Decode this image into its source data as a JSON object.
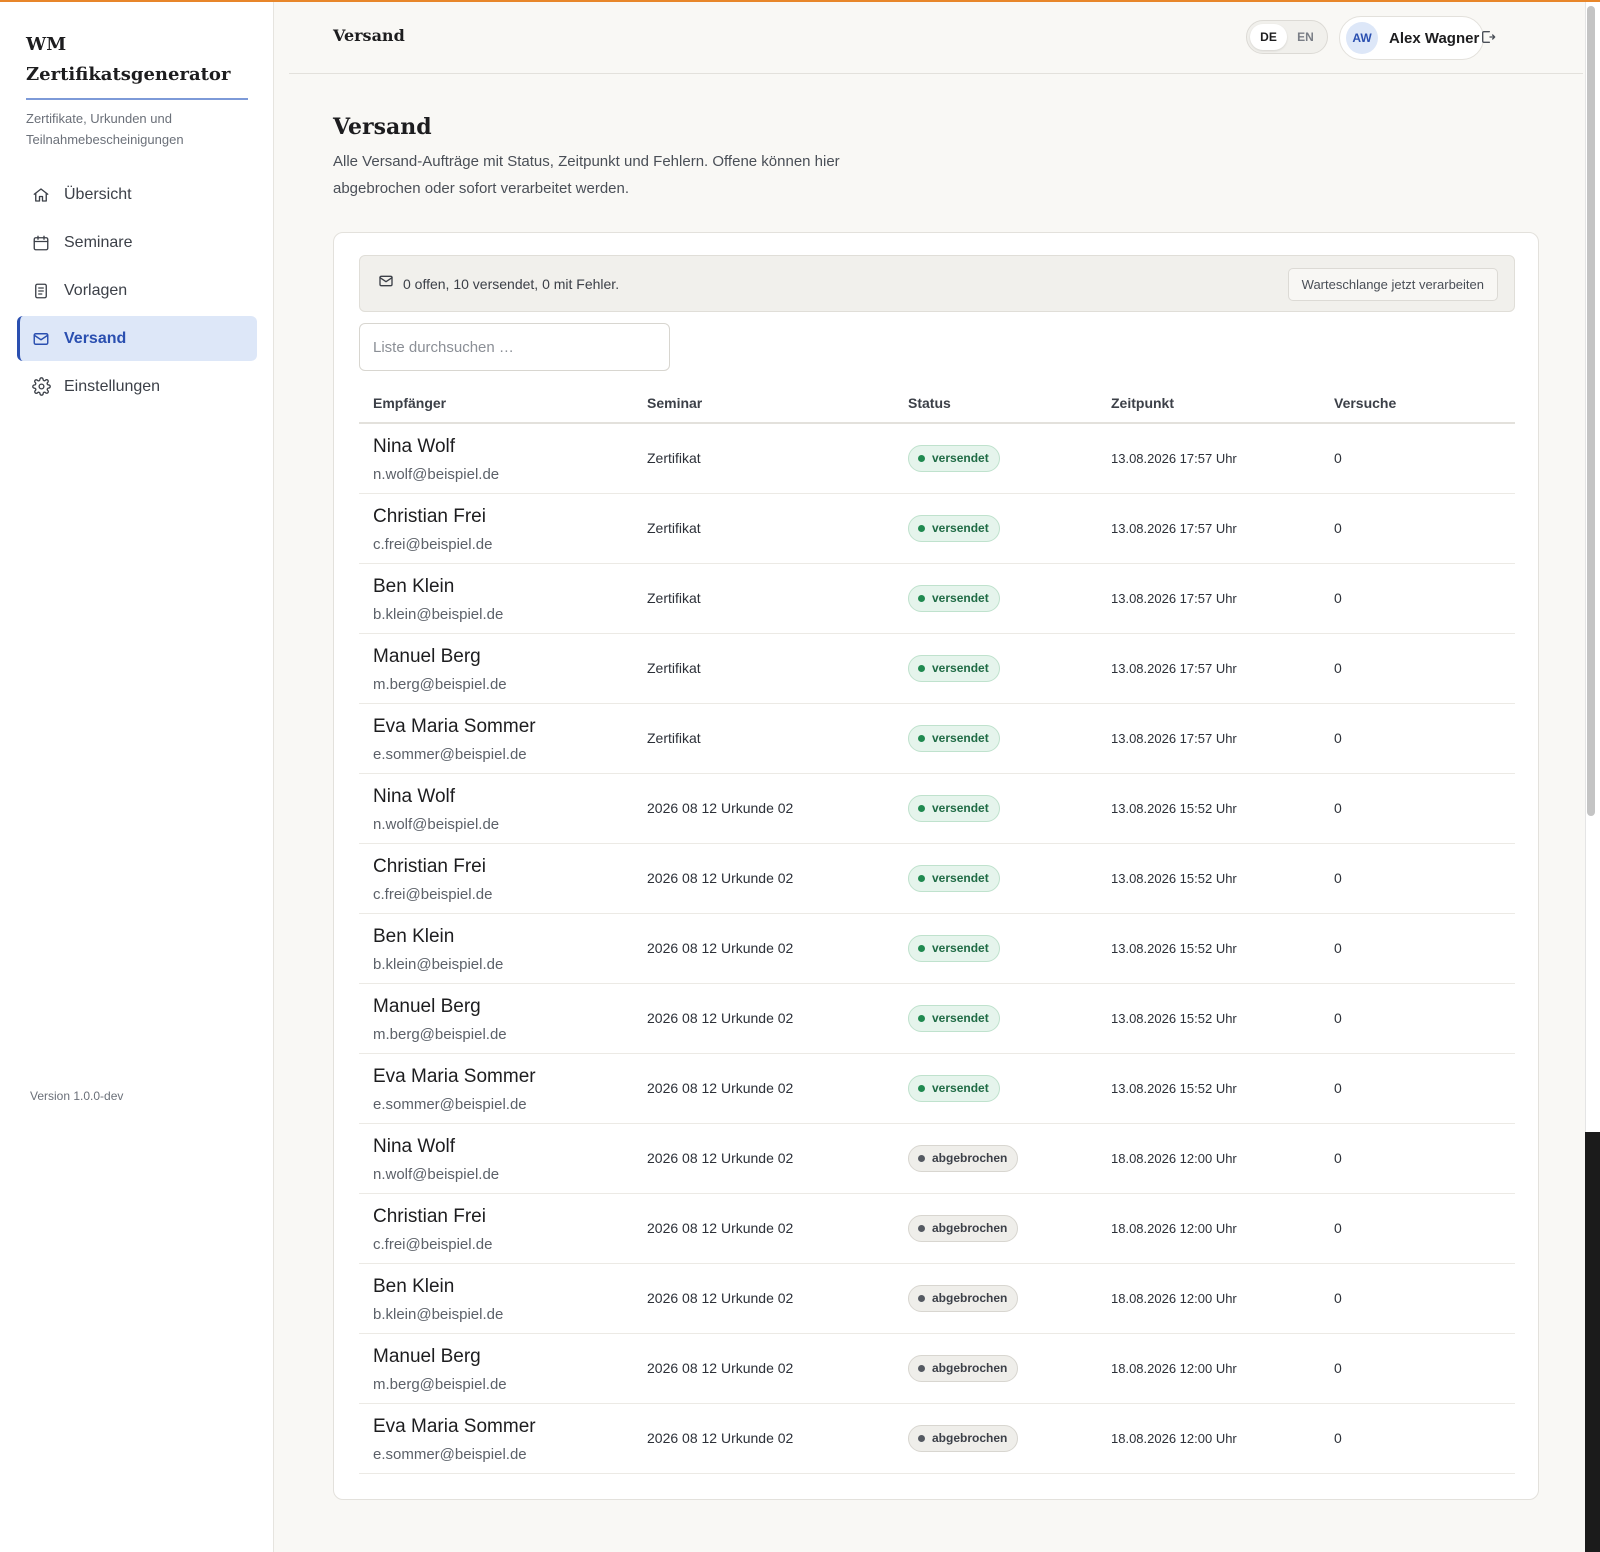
{
  "brand": {
    "title": "WM Zertifikatsgenerator",
    "subtitle": "Zertifikate, Urkunden und Teilnahmebescheinigungen"
  },
  "nav": [
    {
      "label": "Übersicht",
      "icon": "home-icon",
      "active": false
    },
    {
      "label": "Seminare",
      "icon": "calendar-icon",
      "active": false
    },
    {
      "label": "Vorlagen",
      "icon": "document-icon",
      "active": false
    },
    {
      "label": "Versand",
      "icon": "mail-icon",
      "active": true
    },
    {
      "label": "Einstellungen",
      "icon": "gear-icon",
      "active": false
    }
  ],
  "version": "Version 1.0.0-dev",
  "topbar": {
    "title": "Versand",
    "lang_de": "DE",
    "lang_en": "EN",
    "active_lang": "DE",
    "user_initials": "AW",
    "user_name": "Alex Wagner",
    "logout_icon": "logout-icon"
  },
  "page": {
    "title": "Versand",
    "description": "Alle Versand-Aufträge mit Status, Zeitpunkt und Fehlern. Offene können hier abgebrochen oder sofort verarbeitet werden."
  },
  "summary": {
    "text": "0 offen, 10 versendet, 0 mit Fehler.",
    "process_button": "Warteschlange jetzt verarbeiten"
  },
  "search": {
    "placeholder": "Liste durchsuchen …",
    "value": ""
  },
  "table": {
    "headers": [
      "Empfänger",
      "Seminar",
      "Status",
      "Zeitpunkt",
      "Versuche"
    ],
    "rows": [
      {
        "name": "Nina Wolf",
        "email": "n.wolf@beispiel.de",
        "seminar": "Zertifikat",
        "status": "versendet",
        "time": "13.08.2026 17:57 Uhr",
        "attempts": "0"
      },
      {
        "name": "Christian Frei",
        "email": "c.frei@beispiel.de",
        "seminar": "Zertifikat",
        "status": "versendet",
        "time": "13.08.2026 17:57 Uhr",
        "attempts": "0"
      },
      {
        "name": "Ben Klein",
        "email": "b.klein@beispiel.de",
        "seminar": "Zertifikat",
        "status": "versendet",
        "time": "13.08.2026 17:57 Uhr",
        "attempts": "0"
      },
      {
        "name": "Manuel Berg",
        "email": "m.berg@beispiel.de",
        "seminar": "Zertifikat",
        "status": "versendet",
        "time": "13.08.2026 17:57 Uhr",
        "attempts": "0"
      },
      {
        "name": "Eva Maria Sommer",
        "email": "e.sommer@beispiel.de",
        "seminar": "Zertifikat",
        "status": "versendet",
        "time": "13.08.2026 17:57 Uhr",
        "attempts": "0"
      },
      {
        "name": "Nina Wolf",
        "email": "n.wolf@beispiel.de",
        "seminar": "2026 08 12 Urkunde 02",
        "status": "versendet",
        "time": "13.08.2026 15:52 Uhr",
        "attempts": "0"
      },
      {
        "name": "Christian Frei",
        "email": "c.frei@beispiel.de",
        "seminar": "2026 08 12 Urkunde 02",
        "status": "versendet",
        "time": "13.08.2026 15:52 Uhr",
        "attempts": "0"
      },
      {
        "name": "Ben Klein",
        "email": "b.klein@beispiel.de",
        "seminar": "2026 08 12 Urkunde 02",
        "status": "versendet",
        "time": "13.08.2026 15:52 Uhr",
        "attempts": "0"
      },
      {
        "name": "Manuel Berg",
        "email": "m.berg@beispiel.de",
        "seminar": "2026 08 12 Urkunde 02",
        "status": "versendet",
        "time": "13.08.2026 15:52 Uhr",
        "attempts": "0"
      },
      {
        "name": "Eva Maria Sommer",
        "email": "e.sommer@beispiel.de",
        "seminar": "2026 08 12 Urkunde 02",
        "status": "versendet",
        "time": "13.08.2026 15:52 Uhr",
        "attempts": "0"
      },
      {
        "name": "Nina Wolf",
        "email": "n.wolf@beispiel.de",
        "seminar": "2026 08 12 Urkunde 02",
        "status": "abgebrochen",
        "time": "18.08.2026 12:00 Uhr",
        "attempts": "0"
      },
      {
        "name": "Christian Frei",
        "email": "c.frei@beispiel.de",
        "seminar": "2026 08 12 Urkunde 02",
        "status": "abgebrochen",
        "time": "18.08.2026 12:00 Uhr",
        "attempts": "0"
      },
      {
        "name": "Ben Klein",
        "email": "b.klein@beispiel.de",
        "seminar": "2026 08 12 Urkunde 02",
        "status": "abgebrochen",
        "time": "18.08.2026 12:00 Uhr",
        "attempts": "0"
      },
      {
        "name": "Manuel Berg",
        "email": "m.berg@beispiel.de",
        "seminar": "2026 08 12 Urkunde 02",
        "status": "abgebrochen",
        "time": "18.08.2026 12:00 Uhr",
        "attempts": "0"
      },
      {
        "name": "Eva Maria Sommer",
        "email": "e.sommer@beispiel.de",
        "seminar": "2026 08 12 Urkunde 02",
        "status": "abgebrochen",
        "time": "18.08.2026 12:00 Uhr",
        "attempts": "0"
      }
    ]
  },
  "colors": {
    "accent": "#2a4fb0",
    "nav_active_bg": "#dde7f8",
    "top_line": "#e8862a",
    "status_sent": "#1f8a50",
    "status_cancelled": "#555a62"
  }
}
